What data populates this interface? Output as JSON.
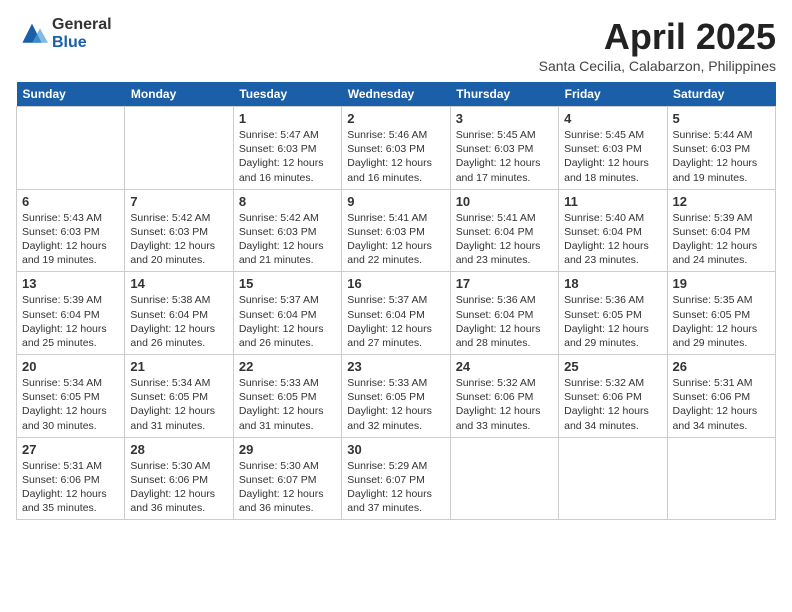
{
  "logo": {
    "general": "General",
    "blue": "Blue"
  },
  "title": "April 2025",
  "location": "Santa Cecilia, Calabarzon, Philippines",
  "weekdays": [
    "Sunday",
    "Monday",
    "Tuesday",
    "Wednesday",
    "Thursday",
    "Friday",
    "Saturday"
  ],
  "weeks": [
    [
      {
        "day": "",
        "info": ""
      },
      {
        "day": "",
        "info": ""
      },
      {
        "day": "1",
        "info": "Sunrise: 5:47 AM\nSunset: 6:03 PM\nDaylight: 12 hours\nand 16 minutes."
      },
      {
        "day": "2",
        "info": "Sunrise: 5:46 AM\nSunset: 6:03 PM\nDaylight: 12 hours\nand 16 minutes."
      },
      {
        "day": "3",
        "info": "Sunrise: 5:45 AM\nSunset: 6:03 PM\nDaylight: 12 hours\nand 17 minutes."
      },
      {
        "day": "4",
        "info": "Sunrise: 5:45 AM\nSunset: 6:03 PM\nDaylight: 12 hours\nand 18 minutes."
      },
      {
        "day": "5",
        "info": "Sunrise: 5:44 AM\nSunset: 6:03 PM\nDaylight: 12 hours\nand 19 minutes."
      }
    ],
    [
      {
        "day": "6",
        "info": "Sunrise: 5:43 AM\nSunset: 6:03 PM\nDaylight: 12 hours\nand 19 minutes."
      },
      {
        "day": "7",
        "info": "Sunrise: 5:42 AM\nSunset: 6:03 PM\nDaylight: 12 hours\nand 20 minutes."
      },
      {
        "day": "8",
        "info": "Sunrise: 5:42 AM\nSunset: 6:03 PM\nDaylight: 12 hours\nand 21 minutes."
      },
      {
        "day": "9",
        "info": "Sunrise: 5:41 AM\nSunset: 6:03 PM\nDaylight: 12 hours\nand 22 minutes."
      },
      {
        "day": "10",
        "info": "Sunrise: 5:41 AM\nSunset: 6:04 PM\nDaylight: 12 hours\nand 23 minutes."
      },
      {
        "day": "11",
        "info": "Sunrise: 5:40 AM\nSunset: 6:04 PM\nDaylight: 12 hours\nand 23 minutes."
      },
      {
        "day": "12",
        "info": "Sunrise: 5:39 AM\nSunset: 6:04 PM\nDaylight: 12 hours\nand 24 minutes."
      }
    ],
    [
      {
        "day": "13",
        "info": "Sunrise: 5:39 AM\nSunset: 6:04 PM\nDaylight: 12 hours\nand 25 minutes."
      },
      {
        "day": "14",
        "info": "Sunrise: 5:38 AM\nSunset: 6:04 PM\nDaylight: 12 hours\nand 26 minutes."
      },
      {
        "day": "15",
        "info": "Sunrise: 5:37 AM\nSunset: 6:04 PM\nDaylight: 12 hours\nand 26 minutes."
      },
      {
        "day": "16",
        "info": "Sunrise: 5:37 AM\nSunset: 6:04 PM\nDaylight: 12 hours\nand 27 minutes."
      },
      {
        "day": "17",
        "info": "Sunrise: 5:36 AM\nSunset: 6:04 PM\nDaylight: 12 hours\nand 28 minutes."
      },
      {
        "day": "18",
        "info": "Sunrise: 5:36 AM\nSunset: 6:05 PM\nDaylight: 12 hours\nand 29 minutes."
      },
      {
        "day": "19",
        "info": "Sunrise: 5:35 AM\nSunset: 6:05 PM\nDaylight: 12 hours\nand 29 minutes."
      }
    ],
    [
      {
        "day": "20",
        "info": "Sunrise: 5:34 AM\nSunset: 6:05 PM\nDaylight: 12 hours\nand 30 minutes."
      },
      {
        "day": "21",
        "info": "Sunrise: 5:34 AM\nSunset: 6:05 PM\nDaylight: 12 hours\nand 31 minutes."
      },
      {
        "day": "22",
        "info": "Sunrise: 5:33 AM\nSunset: 6:05 PM\nDaylight: 12 hours\nand 31 minutes."
      },
      {
        "day": "23",
        "info": "Sunrise: 5:33 AM\nSunset: 6:05 PM\nDaylight: 12 hours\nand 32 minutes."
      },
      {
        "day": "24",
        "info": "Sunrise: 5:32 AM\nSunset: 6:06 PM\nDaylight: 12 hours\nand 33 minutes."
      },
      {
        "day": "25",
        "info": "Sunrise: 5:32 AM\nSunset: 6:06 PM\nDaylight: 12 hours\nand 34 minutes."
      },
      {
        "day": "26",
        "info": "Sunrise: 5:31 AM\nSunset: 6:06 PM\nDaylight: 12 hours\nand 34 minutes."
      }
    ],
    [
      {
        "day": "27",
        "info": "Sunrise: 5:31 AM\nSunset: 6:06 PM\nDaylight: 12 hours\nand 35 minutes."
      },
      {
        "day": "28",
        "info": "Sunrise: 5:30 AM\nSunset: 6:06 PM\nDaylight: 12 hours\nand 36 minutes."
      },
      {
        "day": "29",
        "info": "Sunrise: 5:30 AM\nSunset: 6:07 PM\nDaylight: 12 hours\nand 36 minutes."
      },
      {
        "day": "30",
        "info": "Sunrise: 5:29 AM\nSunset: 6:07 PM\nDaylight: 12 hours\nand 37 minutes."
      },
      {
        "day": "",
        "info": ""
      },
      {
        "day": "",
        "info": ""
      },
      {
        "day": "",
        "info": ""
      }
    ]
  ]
}
